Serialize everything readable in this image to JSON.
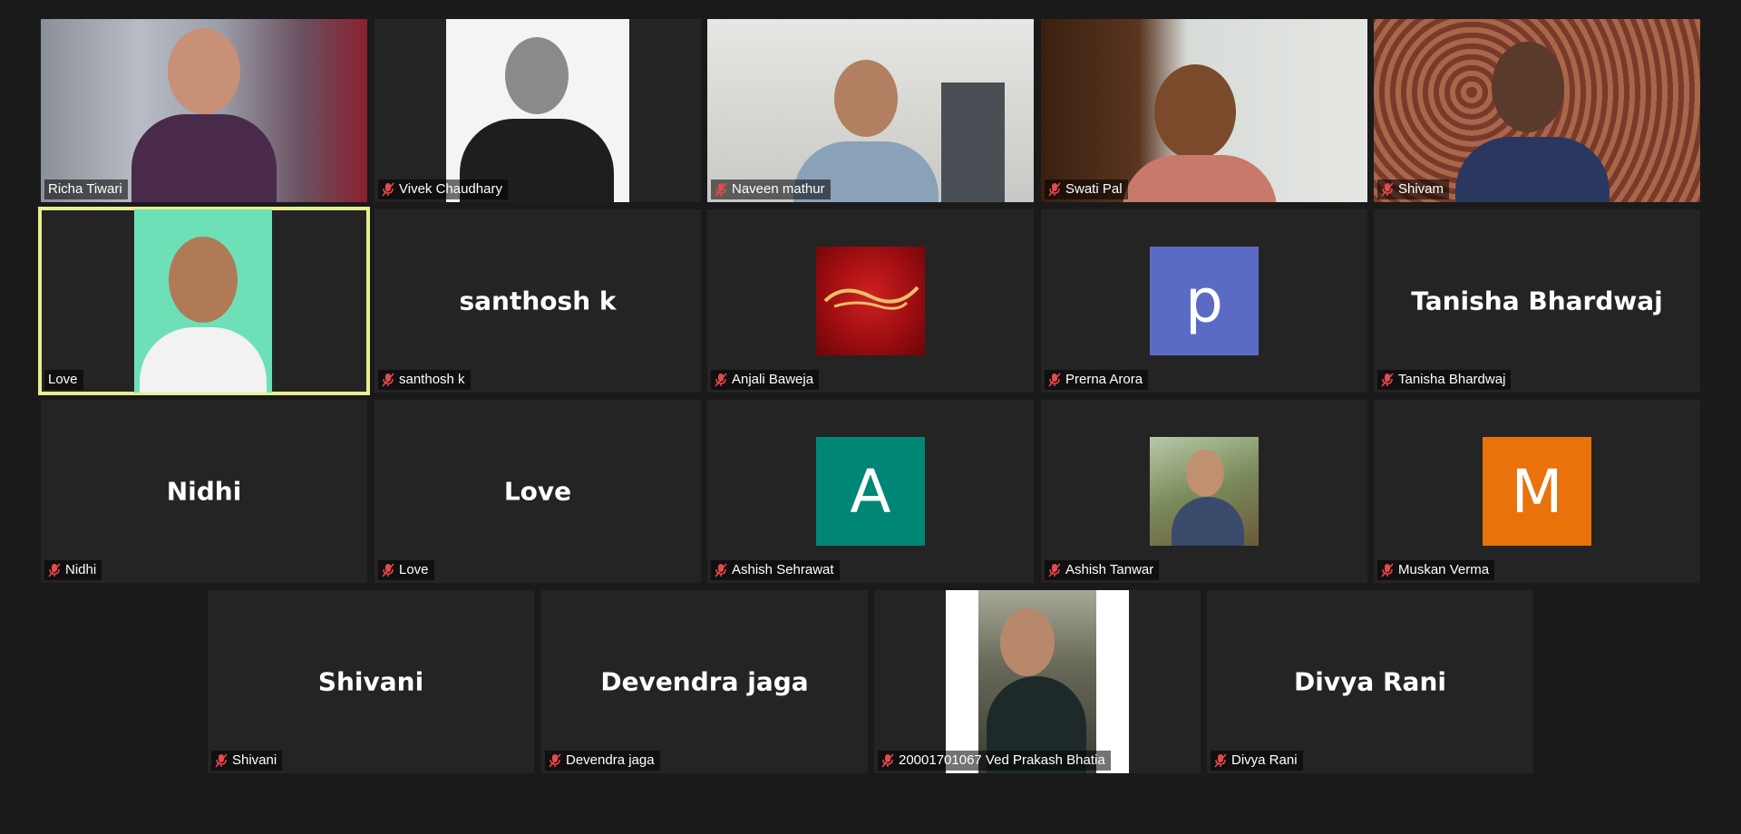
{
  "participants": [
    {
      "name": "Richa Tiwari",
      "muted": false
    },
    {
      "name": "Vivek Chaudhary",
      "muted": true
    },
    {
      "name": "Naveen mathur",
      "muted": true
    },
    {
      "name": "Swati Pal",
      "muted": true
    },
    {
      "name": "Shivam",
      "muted": true
    },
    {
      "name": "Love",
      "muted": false,
      "active_speaker": true
    },
    {
      "name": "santhosh k",
      "display": "santhosh k",
      "muted": true
    },
    {
      "name": "Anjali Baweja",
      "muted": true,
      "avatar": "name-necklace-photo"
    },
    {
      "name": "Prerna Arora",
      "muted": true,
      "avatar_letter": "p",
      "avatar_color": "#5b6bc5"
    },
    {
      "name": "Tanisha Bhardwaj",
      "display": "Tanisha Bhardwaj",
      "muted": true
    },
    {
      "name": "Nidhi",
      "display": "Nidhi",
      "muted": true
    },
    {
      "name": "Love",
      "display": "Love",
      "muted": true
    },
    {
      "name": "Ashish Sehrawat",
      "muted": true,
      "avatar_letter": "A",
      "avatar_color": "#008675"
    },
    {
      "name": "Ashish Tanwar",
      "muted": true,
      "avatar": "profile-photo"
    },
    {
      "name": "Muskan Verma",
      "muted": true,
      "avatar_letter": "M",
      "avatar_color": "#e9720a"
    },
    {
      "name": "Shivani",
      "display": "Shivani",
      "muted": true
    },
    {
      "name": "Devendra jaga",
      "display": "Devendra jaga",
      "muted": true
    },
    {
      "name": "20001701067 Ved Prakash Bhatia",
      "muted": true
    },
    {
      "name": "Divya Rani",
      "display": "Divya Rani",
      "muted": true
    }
  ],
  "icons": {
    "mute": "mic-muted-icon"
  },
  "colors": {
    "background": "#1a1a1a",
    "tile": "#242424",
    "active_outline": "#e8ee8f",
    "mute_red": "#e5484d"
  }
}
